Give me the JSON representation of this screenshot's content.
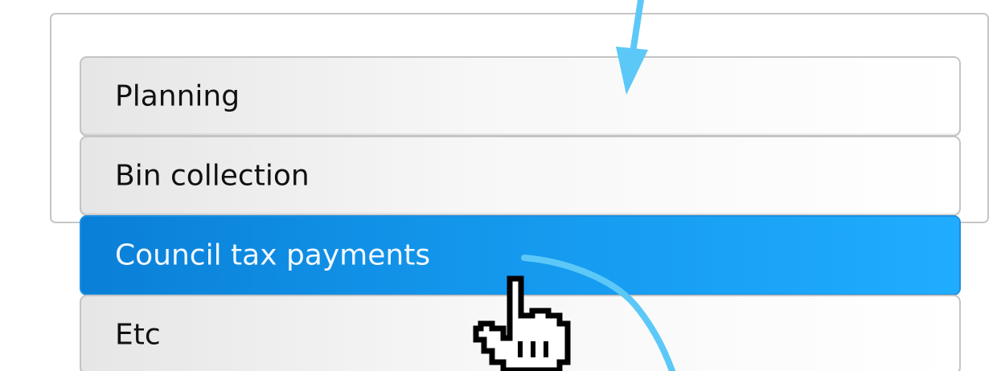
{
  "menu": {
    "items": [
      {
        "label": "Planning"
      },
      {
        "label": "Bin collection"
      },
      {
        "label": "Council tax payments",
        "state": "highlighted"
      },
      {
        "label": "Etc"
      }
    ]
  },
  "colors": {
    "highlight": "#1397ec",
    "arrow": "#5cc8f8",
    "border": "#c4c4c4"
  },
  "icons": {
    "pointer": "hand-pointer-icon",
    "arrow": "down-arrow-icon"
  }
}
